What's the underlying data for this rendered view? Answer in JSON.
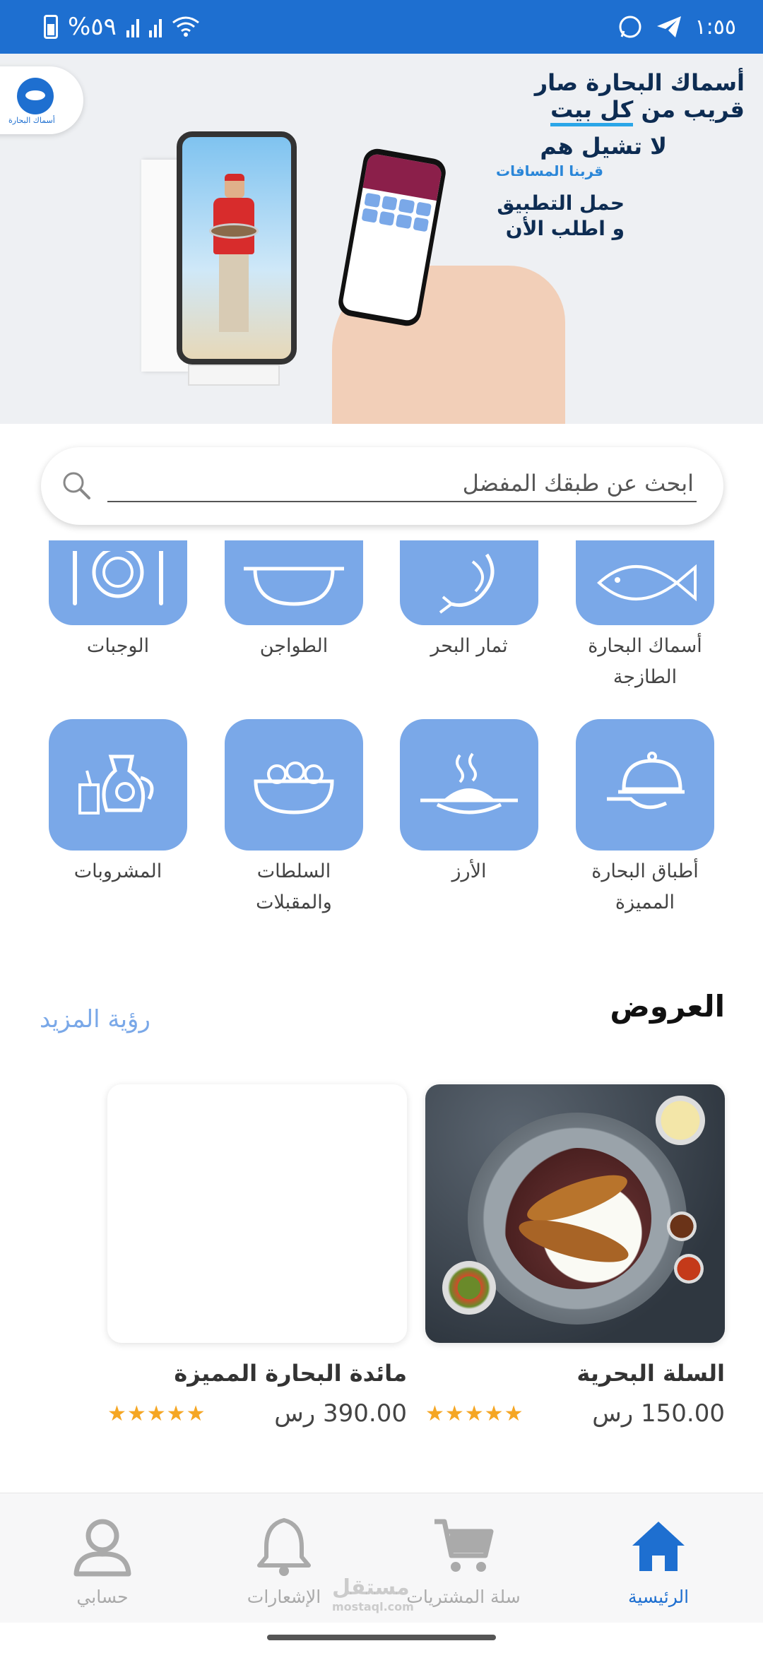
{
  "status_bar": {
    "battery": "%٥٩",
    "time": "١:٥٥"
  },
  "banner": {
    "line1": "أسماك البحارة صار",
    "line2_pre": "قريب من ",
    "line2_hl": "كل بيت",
    "line3": "لا تشيل هم",
    "line4": "قربنا المسافات",
    "line5a": "حمل التطبيق",
    "line5b": "و اطلب الأن",
    "logo_text": "أسماك البحارة"
  },
  "search": {
    "placeholder": "ابحث عن طبقك المفضل"
  },
  "categories": [
    {
      "label": "أسماك البحارة الطازجة",
      "icon": "fish-icon"
    },
    {
      "label": "ثمار البحر",
      "icon": "shrimp-icon"
    },
    {
      "label": "الطواجن",
      "icon": "pot-icon"
    },
    {
      "label": "الوجبات",
      "icon": "plate-cutlery-icon"
    },
    {
      "label": "أطباق البحارة المميزة",
      "icon": "serving-cloche-icon"
    },
    {
      "label": "الأرز",
      "icon": "rice-dish-icon"
    },
    {
      "label": "السلطات والمقبلات",
      "icon": "salad-bowl-icon"
    },
    {
      "label": "المشروبات",
      "icon": "drinks-icon"
    }
  ],
  "offers": {
    "title": "العروض",
    "see_more": "رؤية المزيد",
    "items": [
      {
        "name": "السلة البحرية",
        "price": "150.00 رس",
        "rating": 5
      },
      {
        "name": "مائدة البحارة المميزة",
        "price": "390.00 رس",
        "rating": 5
      }
    ]
  },
  "bottom_nav": {
    "items": [
      {
        "label": "الرئيسية",
        "icon": "home-icon",
        "active": true
      },
      {
        "label": "سلة المشتريات",
        "icon": "cart-icon",
        "active": false
      },
      {
        "label": "الإشعارات",
        "icon": "bell-icon",
        "active": false
      },
      {
        "label": "حسابي",
        "icon": "user-icon",
        "active": false
      }
    ]
  },
  "watermark": {
    "main": "مستقل",
    "sub": "mostaql.com"
  },
  "colors": {
    "primary": "#1e6fd0",
    "tile": "#7aa8e8",
    "star": "#f5a623"
  }
}
